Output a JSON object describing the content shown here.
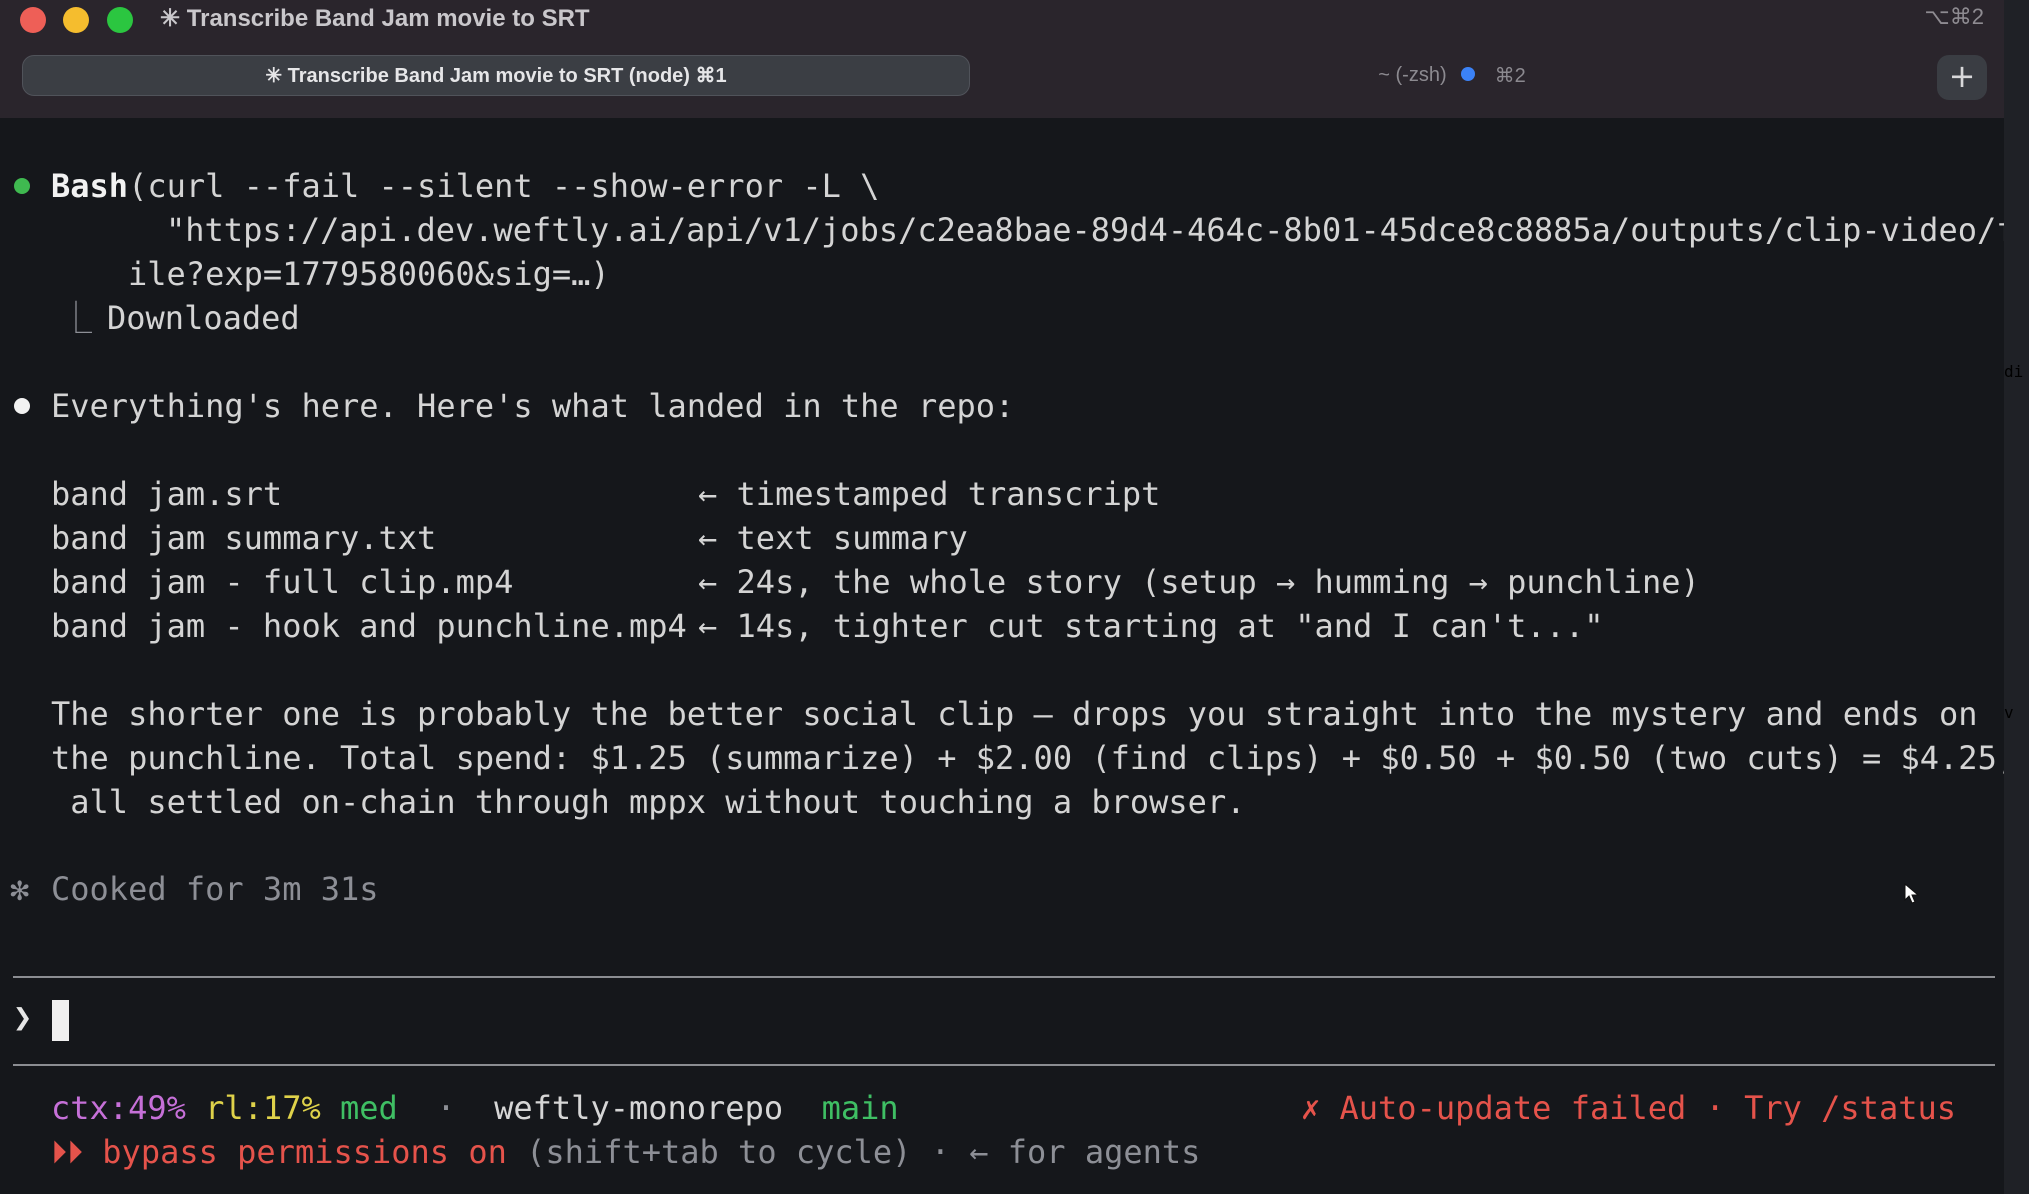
{
  "window": {
    "title": "✳ Transcribe Band Jam movie to SRT",
    "shortcut": "⌥⌘2"
  },
  "tabs": [
    {
      "label": "✳ Transcribe Band Jam movie to SRT (node) ⌘1",
      "active": true
    },
    {
      "label": "~ (-zsh)",
      "shortcut": "⌘2",
      "active": false
    }
  ],
  "new_tab": "+",
  "bash_block": {
    "tool": "Bash",
    "line1": "(curl --fail --silent --show-error -L \\",
    "line2": "\"https://api.dev.weftly.ai/api/v1/jobs/c2ea8bae-89d4-464c-8b01-45dce8c8885a/outputs/clip-video/f",
    "line3": "ile?exp=1779580060&sig=…)",
    "result_branch": "⎿",
    "result": "Downloaded"
  },
  "message": {
    "intro": "Everything's here. Here's what landed in the repo:",
    "files": [
      {
        "name": "band jam.srt",
        "desc": "← timestamped transcript"
      },
      {
        "name": "band jam summary.txt",
        "desc": "← text summary"
      },
      {
        "name": "band jam - full clip.mp4",
        "desc": "← 24s, the whole story (setup → humming → punchline)"
      },
      {
        "name": "band jam - hook and punchline.mp4",
        "desc": "← 14s, tighter cut starting at \"and I can't...\""
      }
    ],
    "para_lines": [
      "The shorter one is probably the better social clip — drops you straight into the mystery and ends on",
      "the punchline. Total spend: $1.25 (summarize) + $2.00 (find clips) + $0.50 + $0.50 (two cuts) = $4.25,",
      " all settled on-chain through mppx without touching a browser."
    ]
  },
  "cooked": {
    "star": "✻",
    "text": "Cooked for 3m 31s"
  },
  "prompt": {
    "glyph": "❯",
    "value": ""
  },
  "status": {
    "ctx": "ctx:49%",
    "rl": "rl:17%",
    "effort": "med",
    "sep": "·",
    "repo": "weftly-monorepo",
    "branch": "main",
    "error": "✗ Auto-update failed · Try /status",
    "perm_arrows": "⏵⏵",
    "perm_label": "bypass permissions on",
    "perm_hint": " (shift+tab to cycle) · ← for agents"
  },
  "side_fragments": [
    "di",
    "v"
  ],
  "colors": {
    "bullet_tool": "#3fb950",
    "bullet_message": "#f2f2f2",
    "error": "#e5534b",
    "ctx": "#c670d8",
    "rl": "#dfd24a",
    "branch": "#3fbf64",
    "tab_dot": "#3b82f6"
  }
}
